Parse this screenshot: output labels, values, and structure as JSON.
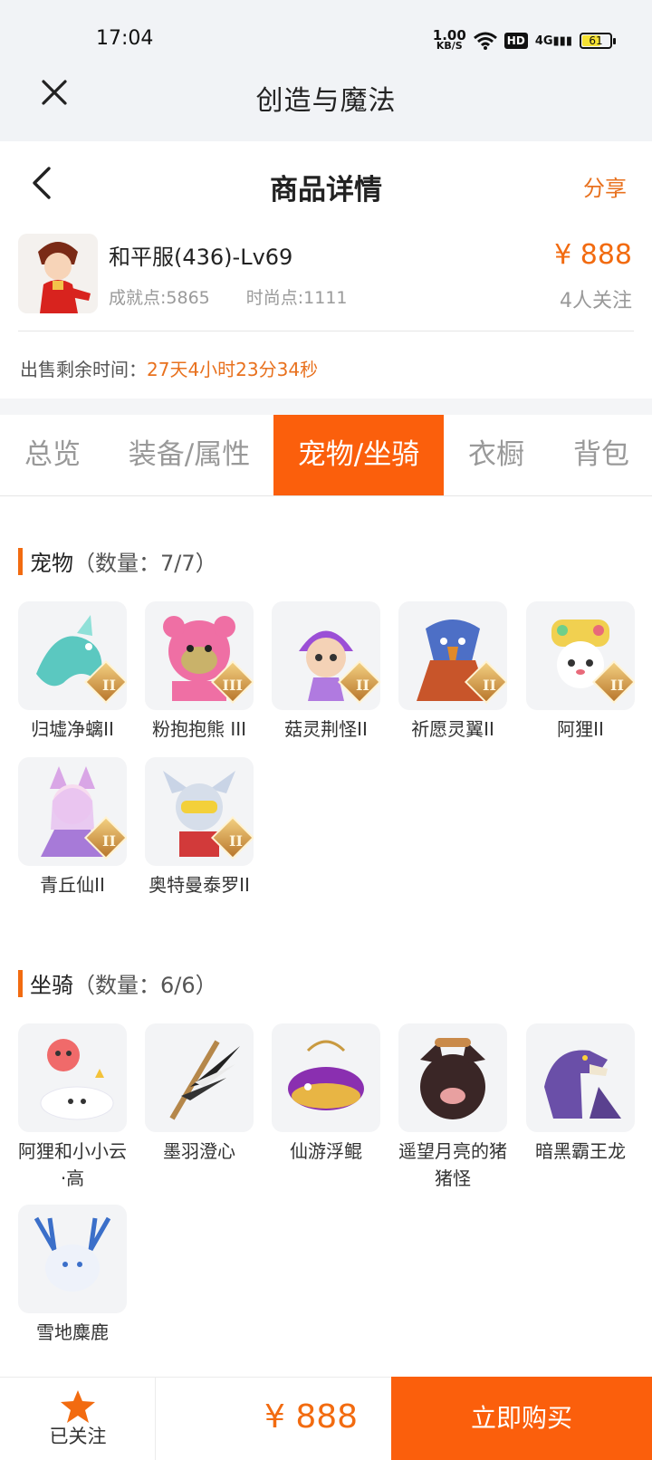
{
  "status": {
    "time": "17:04",
    "speed_value": "1.00",
    "speed_unit": "KB/S",
    "hd": "HD",
    "net": "4G",
    "battery": "61"
  },
  "app": {
    "title": "创造与魔法",
    "close_icon": "close-icon"
  },
  "header": {
    "title": "商品详情",
    "share": "分享",
    "back_icon": "chevron-left-icon"
  },
  "product": {
    "name": "和平服(436)-Lv69",
    "achievement": "成就点:5865",
    "fashion": "时尚点:1111",
    "price": "¥ 888",
    "followers": "4人关注",
    "remain_label": "出售剩余时间：",
    "remain_value": "27天4小时23分34秒"
  },
  "tabs": [
    {
      "label": "总览",
      "active": false
    },
    {
      "label": "装备/属性",
      "active": false
    },
    {
      "label": "宠物/坐骑",
      "active": true
    },
    {
      "label": "衣橱",
      "active": false
    },
    {
      "label": "背包",
      "active": false
    }
  ],
  "pets": {
    "title": "宠物",
    "count": "（数量：7/7）",
    "items": [
      {
        "name": "归墟净螭II",
        "badge": "II"
      },
      {
        "name": "粉抱抱熊 III",
        "badge": "III"
      },
      {
        "name": "菇灵荆怪II",
        "badge": "II"
      },
      {
        "name": "祈愿灵翼II",
        "badge": "II"
      },
      {
        "name": "阿狸II",
        "badge": "II"
      },
      {
        "name": "青丘仙II",
        "badge": "II"
      },
      {
        "name": "奥特曼泰罗II",
        "badge": "II"
      }
    ]
  },
  "mounts": {
    "title": "坐骑",
    "count": "（数量：6/6）",
    "items": [
      {
        "name": "阿狸和小小云·高"
      },
      {
        "name": "墨羽澄心"
      },
      {
        "name": "仙游浮鲲"
      },
      {
        "name": "遥望月亮的猪猪怪"
      },
      {
        "name": "暗黑霸王龙"
      },
      {
        "name": "雪地麋鹿"
      }
    ]
  },
  "bottom": {
    "follow_label": "已关注",
    "price": "¥ 888",
    "buy": "立即购买",
    "star_icon": "star-icon"
  },
  "colors": {
    "accent": "#fb5f0c",
    "price": "#f26b10",
    "bg": "#f1f3f6"
  }
}
